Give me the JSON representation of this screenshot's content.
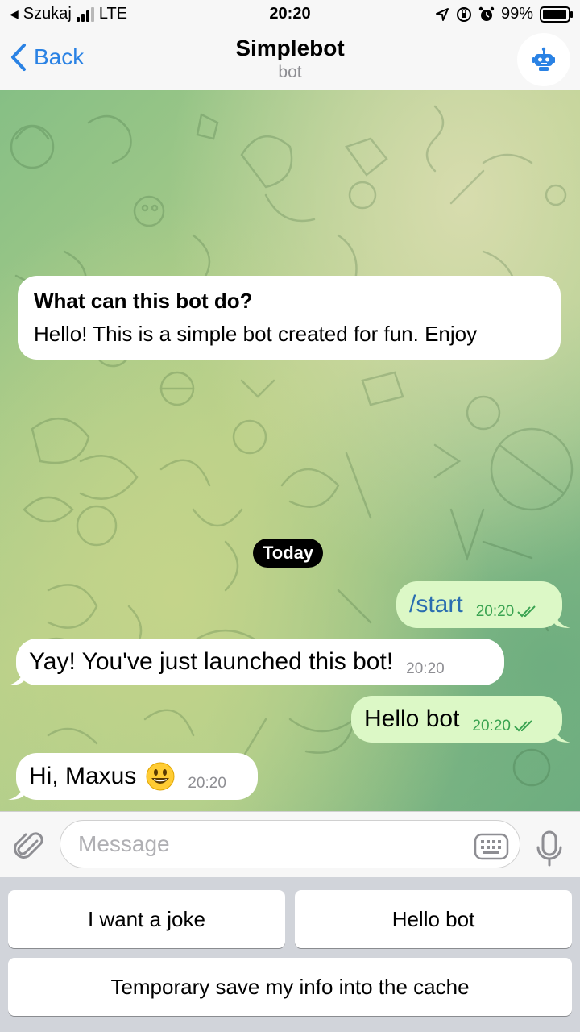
{
  "status": {
    "carrier": "Szukaj",
    "network": "LTE",
    "time": "20:20",
    "battery": "99%"
  },
  "header": {
    "back_label": "Back",
    "title": "Simplebot",
    "subtitle": "bot"
  },
  "info_card": {
    "title": "What can this bot do?",
    "text": "Hello!  This is a simple bot created for fun. Enjoy"
  },
  "date_separator": "Today",
  "messages": [
    {
      "direction": "out",
      "text": "/start",
      "time": "20:20"
    },
    {
      "direction": "in",
      "text": "Yay! You've just launched this bot!",
      "time": "20:20"
    },
    {
      "direction": "out",
      "text": "Hello bot",
      "time": "20:20"
    },
    {
      "direction": "in",
      "text": "Hi, Maxus",
      "time": "20:20",
      "emoji": "smiling-face-emoji"
    }
  ],
  "composer": {
    "placeholder": "Message"
  },
  "keyboard": {
    "buttons": [
      {
        "label": "I want a joke"
      },
      {
        "label": "Hello bot"
      },
      {
        "label": "Temporary save my info into the cache"
      }
    ]
  },
  "colors": {
    "accent": "#2a82e4",
    "outgoing_bubble": "#dcf8c6",
    "incoming_bubble": "#ffffff",
    "read_check": "#3aa351"
  },
  "icons": [
    "location-arrow-icon",
    "orientation-lock-icon",
    "alarm-icon",
    "chevron-left-icon",
    "robot-icon",
    "double-check-icon",
    "paperclip-icon",
    "keyboard-icon",
    "microphone-icon"
  ]
}
